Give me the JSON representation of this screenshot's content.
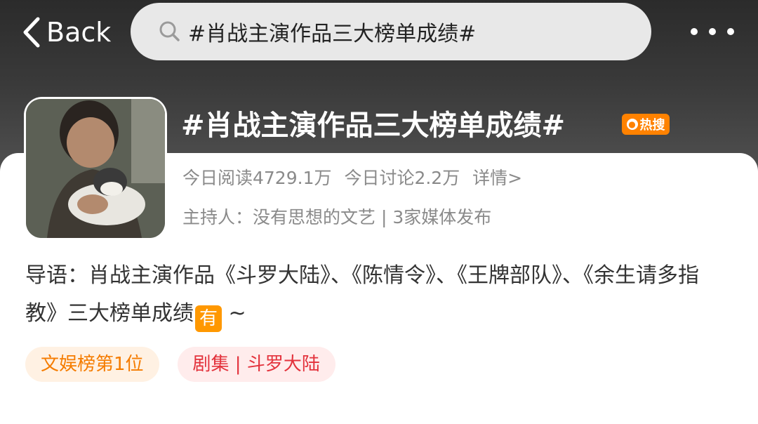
{
  "header": {
    "back_label": "Back",
    "search_query": "#肖战主演作品三大榜单成绩#"
  },
  "topic": {
    "title": "#肖战主演作品三大榜单成绩#",
    "hot_badge": "热搜",
    "stats": {
      "read_today": "今日阅读4729.1万",
      "discuss_today": "今日讨论2.2万",
      "details_link": "详情>"
    },
    "host_line": "主持人：没有思想的文艺 | 3家媒体发布",
    "intro": "导语：肖战主演作品《斗罗大陆》、《陈情令》、《王牌部队》、《余生请多指教》三大榜单成绩",
    "intro_badge": "有",
    "intro_suffix": " ~"
  },
  "tags": [
    {
      "label": "文娱榜第1位",
      "color": "#f57c00"
    },
    {
      "label": "剧集 | 斗罗大陆",
      "color": "#e3323c"
    }
  ],
  "icons": [
    "chevron-left-icon",
    "search-icon",
    "more-dots-icon",
    "hot-flame-icon"
  ],
  "colors": {
    "accent_orange": "#ff8200",
    "tag_red": "#e3323c"
  }
}
